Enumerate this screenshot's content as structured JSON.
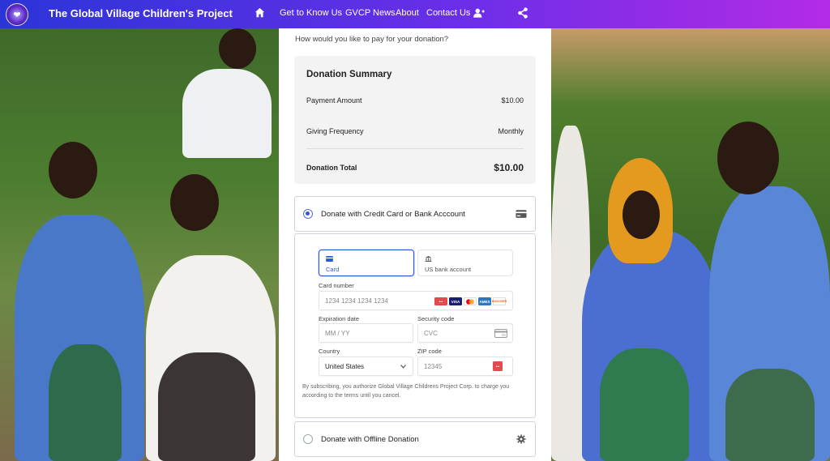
{
  "nav": {
    "brand": "The Global Village Children's Project",
    "links": [
      "Get to Know Us",
      "GVCP News",
      "About",
      "Contact Us"
    ],
    "icons": [
      "home-icon",
      "user-plus-icon",
      "share-icon"
    ]
  },
  "donation": {
    "question": "How would you like to pay for your donation?",
    "summary": {
      "title": "Donation Summary",
      "payment_amount_label": "Payment Amount",
      "payment_amount_value": "$10.00",
      "frequency_label": "Giving Frequency",
      "frequency_value": "Monthly",
      "total_label": "Donation Total",
      "total_value": "$10.00"
    },
    "methods": {
      "card": "Donate with Credit Card or Bank Acccount",
      "offline": "Donate with Offline Donation"
    }
  },
  "stripe": {
    "tabs": [
      "Card",
      "US bank account"
    ],
    "card_number_label": "Card number",
    "card_number_placeholder": "1234 1234 1234 1234",
    "card_brands": [
      "VISA",
      "MC",
      "AMEX",
      "DISCOVER"
    ],
    "expiry_label": "Expiration date",
    "expiry_placeholder": "MM / YY",
    "cvc_label": "Security code",
    "cvc_placeholder": "CVC",
    "country_label": "Country",
    "country_value": "United States",
    "zip_label": "ZIP code",
    "zip_placeholder": "12345",
    "legal": "By subscribing, you authorize Global Village Childrens Project Corp. to charge you according to the terms until you cancel."
  },
  "colors": {
    "nav_start": "#2a35d8",
    "nav_end": "#b42be6",
    "accent": "#2a5bd7"
  }
}
